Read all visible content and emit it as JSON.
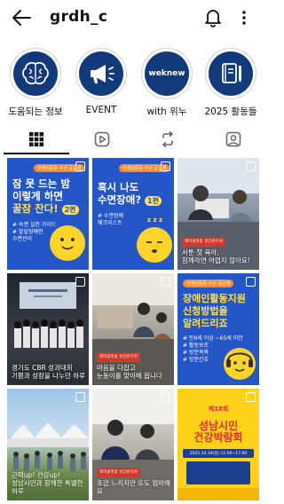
{
  "header": {
    "username": "grdh_c"
  },
  "highlights": [
    {
      "label": "도움되는 정보",
      "icon": "brain-icon"
    },
    {
      "label": "EVENT",
      "icon": "megaphone-icon"
    },
    {
      "label": "with 위누",
      "icon": "weknew-logo",
      "logo_text": "weknew"
    },
    {
      "label": "2025 활동들",
      "icon": "notebook-icon"
    }
  ],
  "tabs": [
    {
      "icon": "grid-icon",
      "selected": true
    },
    {
      "icon": "reels-icon",
      "selected": false
    },
    {
      "icon": "repost-icon",
      "selected": false
    },
    {
      "icon": "tagged-icon",
      "selected": false
    }
  ],
  "posts": {
    "p1": {
      "pill": "장애인활동 주간 공감해",
      "line1": "잠 못 드는 밤",
      "line2": "이렇게 하면",
      "line3": "꿀잠 잔다!",
      "badge": "2편",
      "bullets": [
        "# 숙면 실천 가이드",
        "# 발달장애인",
        "수면관리"
      ]
    },
    "p2": {
      "pill": "장애인활동 주간 공감해",
      "line1": "혹시 나도",
      "line2": "수면장애?",
      "badge": "1편",
      "bullets": [
        "# 수면장애",
        "체크리스트"
      ],
      "zzz": "z z z"
    },
    "p3": {
      "tag": "해피플랫폼 성장원지원",
      "caption": "서툰 첫 육아,\n함께라면 어렵지 않아요!"
    },
    "p4": {
      "caption": "경기도 CBR 성과대회\n기쁨과 성장을 나누던 하루"
    },
    "p5": {
      "tag": "해피플랫폼 성장원지원",
      "caption": "마음을 다잡고\n눈동이를 맞이해 봅니다"
    },
    "p6": {
      "pill": "장애인활동 주간 공감해",
      "line1": "장애인활동지원",
      "line2": "신청방법을",
      "line3": "알려드리죠",
      "bullets": [
        "# 만6세 이상 ~65세 미만",
        "# 활동보조",
        "# 방문목욕",
        "# 방문간호"
      ]
    },
    "p7": {
      "caption": "근력up! 건강up!\n성남시민과 함께한 특별한 하루"
    },
    "p8": {
      "tag": "해피플랫폼 성장원지원",
      "caption": "조금 느리지만 또도 엄마예요"
    },
    "p9": {
      "line0": "제18회",
      "line1": "성남시민",
      "line2": "건강박람회",
      "date": "2025.10.19(일) 11:00~17:00"
    }
  },
  "colors": {
    "navy": "#123a7a",
    "post_blue": "#2456c8",
    "yellow": "#ffe24d",
    "orange": "#ff8a2a"
  }
}
